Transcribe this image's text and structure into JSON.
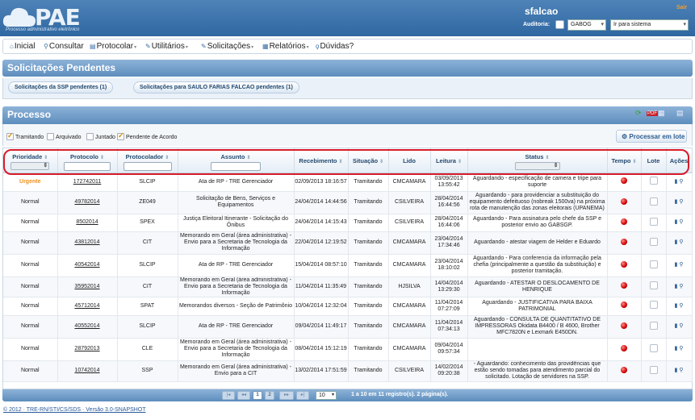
{
  "header": {
    "logo_text": "PAE",
    "logo_sub": "Processo administrativo eletrônico",
    "username": "sfalcao",
    "logout": "Sair",
    "auditoria_label": "Auditoria:",
    "unit_select": "GABOG",
    "system_select": "Ir para sistema"
  },
  "menu": [
    {
      "label": "Inicial",
      "icon": "home-icon",
      "glyph": "⌂",
      "caret": false
    },
    {
      "label": "Consultar",
      "icon": "search-icon",
      "glyph": "⚲",
      "caret": false
    },
    {
      "label": "Protocolar",
      "icon": "document-icon",
      "glyph": "▤",
      "caret": true
    },
    {
      "label": "Utilitários",
      "icon": "wrench-icon",
      "glyph": "✎",
      "caret": true
    },
    {
      "label": "Solicitações",
      "icon": "pencil-icon",
      "glyph": "✎",
      "caret": true
    },
    {
      "label": "Relatórios",
      "icon": "report-icon",
      "glyph": "▦",
      "caret": true
    },
    {
      "label": "Dúvidas?",
      "icon": "bulb-icon",
      "glyph": "ϙ",
      "caret": false
    }
  ],
  "pending": {
    "title": "Solicitações Pendentes",
    "buttons": [
      "Solicitações da SSP pendentes (1)",
      "Solicitações para SAULO FARIAS FALCAO pendentes (1)"
    ]
  },
  "process": {
    "title": "Processo",
    "filters": [
      {
        "label": "Tramitando",
        "checked": true
      },
      {
        "label": "Arquivado",
        "checked": false
      },
      {
        "label": "Juntado",
        "checked": false
      },
      {
        "label": "Pendente de Acordo",
        "checked": true
      }
    ],
    "lote_button": "Processar em lote"
  },
  "table": {
    "headers": [
      "Prioridade",
      "Protocolo",
      "Protocolador",
      "Assunto",
      "Recebimento",
      "Situação",
      "Lido",
      "Leitura",
      "Status",
      "Tempo",
      "Lote",
      "Ações"
    ],
    "rows": [
      {
        "prioridade": "Urgente",
        "protocolo": "172742011",
        "protocolador": "SLCIP",
        "assunto": "Ata de RP - TRE Gerenciador",
        "recebimento": "02/09/2013 18:16:57",
        "situacao": "Tramitando",
        "lido": "CMCAMARA",
        "leitura": "03/09/2013 13:55:42",
        "status": "Aguardando - especificação de camera e tripe para suporte"
      },
      {
        "prioridade": "Normal",
        "protocolo": "49782014",
        "protocolador": "ZE049",
        "assunto": "Solicitação de Bens, Serviços e Equipamentos",
        "recebimento": "24/04/2014 14:44:56",
        "situacao": "Tramitando",
        "lido": "CSILVEIRA",
        "leitura": "28/04/2014 16:44:56",
        "status": "Aguardando - para providenciar a substituição do equipamento defeituoso (nobreak 1500va) na próxima rota de manutenção das zonas eleitorais (UPANEMA)"
      },
      {
        "prioridade": "Normal",
        "protocolo": "8502014",
        "protocolador": "SPEX",
        "assunto": "Justiça Eleitoral Itinerante - Solicitação do Ônibus",
        "recebimento": "24/04/2014 14:15:43",
        "situacao": "Tramitando",
        "lido": "CSILVEIRA",
        "leitura": "28/04/2014 16:44:06",
        "status": "Aguardando - Para assinatura pelo chefe da SSP e posterior envio ao GABSGP."
      },
      {
        "prioridade": "Normal",
        "protocolo": "43812014",
        "protocolador": "CIT",
        "assunto": "Memorando em Geral (área administrativa) - Envio para a Secretaria de Tecnologia da Informação",
        "recebimento": "22/04/2014 12:19:52",
        "situacao": "Tramitando",
        "lido": "CMCAMARA",
        "leitura": "23/04/2014 17:34:46",
        "status": "Aguardando - atestar viagem de Helder e Eduardo"
      },
      {
        "prioridade": "Normal",
        "protocolo": "40542014",
        "protocolador": "SLCIP",
        "assunto": "Ata de RP - TRE Gerenciador",
        "recebimento": "15/04/2014 08:57:10",
        "situacao": "Tramitando",
        "lido": "CMCAMARA",
        "leitura": "23/04/2014 18:10:02",
        "status": "Aguardando - Para conferencia da informação pela chefia (principalmente a questão da substituição) e posterior tramitação."
      },
      {
        "prioridade": "Normal",
        "protocolo": "35952014",
        "protocolador": "CIT",
        "assunto": "Memorando em Geral (área administrativa) - Envio para a Secretaria de Tecnologia da Informação",
        "recebimento": "11/04/2014 11:35:49",
        "situacao": "Tramitando",
        "lido": "HJSILVA",
        "leitura": "14/04/2014 13:29:30",
        "status": "Aguardando - ATESTAR O DESLOCAMENTO DE HENRIQUE"
      },
      {
        "prioridade": "Normal",
        "protocolo": "45712014",
        "protocolador": "SPAT",
        "assunto": "Memorandos diversos - Seção de Patrimônio",
        "recebimento": "10/04/2014 12:32:04",
        "situacao": "Tramitando",
        "lido": "CMCAMARA",
        "leitura": "11/04/2014 07:27:09",
        "status": "Aguardando - JUSTIFICATIVA PARA BAIXA PATRIMONIAL"
      },
      {
        "prioridade": "Normal",
        "protocolo": "40552014",
        "protocolador": "SLCIP",
        "assunto": "Ata de RP - TRE Gerenciador",
        "recebimento": "09/04/2014 11:49:17",
        "situacao": "Tramitando",
        "lido": "CMCAMARA",
        "leitura": "11/04/2014 07:34:13",
        "status": "Aguardando - CONSULTA DE QUANTITATIVO DE IMPRESSORAS Okidata B4400 / B 4600, Brother MFC7820N e Lexmark E450DN."
      },
      {
        "prioridade": "Normal",
        "protocolo": "28792013",
        "protocolador": "CLE",
        "assunto": "Memorando em Geral (área administrativa) - Envio para a Secretaria de Tecnologia da Informação",
        "recebimento": "08/04/2014 15:12:19",
        "situacao": "Tramitando",
        "lido": "CMCAMARA",
        "leitura": "09/04/2014 09:57:34",
        "status": ""
      },
      {
        "prioridade": "Normal",
        "protocolo": "10742014",
        "protocolador": "SSP",
        "assunto": "Memorando em Geral (área administrativa) - Envio para a CIT",
        "recebimento": "13/02/2014 17:51:59",
        "situacao": "Tramitando",
        "lido": "CSILVEIRA",
        "leitura": "14/02/2014 09:20:38",
        "status": "- Aguardando: conhecimento das providências que estão sendo tomadas para atendimento parcial do solicitado. Lotação de servidores na SSP."
      }
    ]
  },
  "pager": {
    "pages": [
      "1",
      "2"
    ],
    "active": "1",
    "page_size": "10",
    "info": "1 a 10 em 11 registro(s). 2 página(s)."
  },
  "footer": "© 2012 · TRE-RN/STI/CS/SDS · Versão 3.0-SNAPSHOT",
  "colors": {
    "urgent": "#f09020",
    "header_blue": "#2f67a1",
    "highlight": "#d81b2b"
  }
}
